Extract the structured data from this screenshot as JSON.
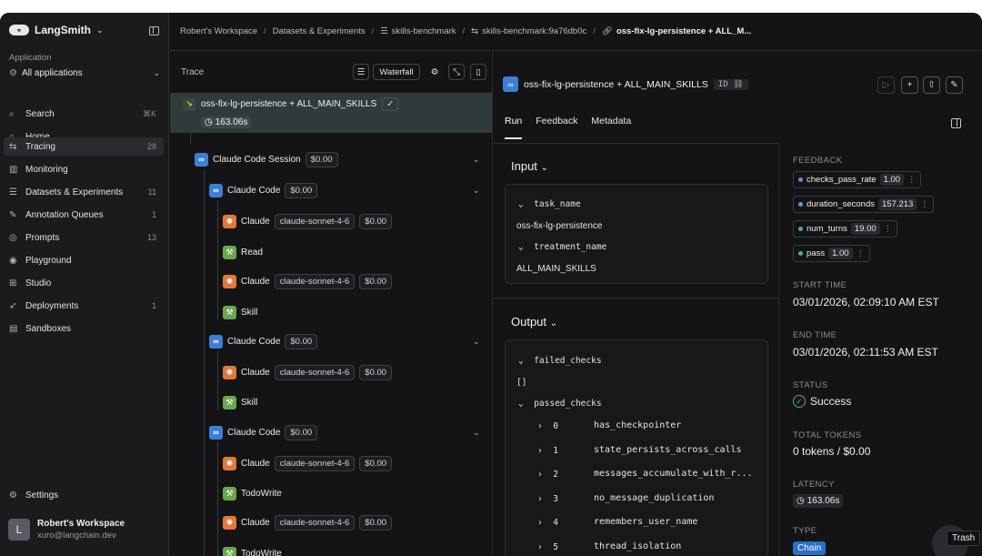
{
  "brand": {
    "name": "LangSmith"
  },
  "sidebar": {
    "app_label": "Application",
    "app_select": "All applications",
    "items": [
      {
        "label": "Search",
        "count": "⌘K",
        "icon": "search-icon"
      },
      {
        "label": "Home",
        "count": "",
        "icon": "home-icon"
      },
      {
        "label": "Tracing",
        "count": "28",
        "icon": "tracing-icon"
      },
      {
        "label": "Monitoring",
        "count": "",
        "icon": "monitoring-icon"
      },
      {
        "label": "Datasets & Experiments",
        "count": "11",
        "icon": "datasets-icon"
      },
      {
        "label": "Annotation Queues",
        "count": "1",
        "icon": "annotation-icon"
      },
      {
        "label": "Prompts",
        "count": "13",
        "icon": "prompts-icon"
      },
      {
        "label": "Playground",
        "count": "",
        "icon": "playground-icon"
      },
      {
        "label": "Studio",
        "count": "",
        "icon": "studio-icon"
      },
      {
        "label": "Deployments",
        "count": "1",
        "icon": "deployments-icon"
      },
      {
        "label": "Sandboxes",
        "count": "",
        "icon": "sandboxes-icon"
      }
    ],
    "settings": "Settings",
    "workspace": {
      "initial": "L",
      "name": "Robert's Workspace",
      "email": "xuro@langchain.dev"
    }
  },
  "breadcrumb": [
    "Robert's Workspace",
    "Datasets & Experiments",
    "skills-benchmark",
    "skills-benchmark:9a76db0c",
    "oss-fix-lg-persistence + ALL_M..."
  ],
  "trace": {
    "label": "Trace",
    "waterfall": "Waterfall",
    "root": {
      "title": "oss-fix-lg-persistence + ALL_MAIN_SKILLS",
      "time": "163.06s"
    },
    "session": {
      "title": "Claude Code Session",
      "cost": "$0.00"
    },
    "rows": [
      {
        "kind": "code",
        "label": "Claude Code",
        "cost": "$0.00"
      },
      {
        "kind": "llm",
        "label": "Claude",
        "model": "claude-sonnet-4-6",
        "cost": "$0.00"
      },
      {
        "kind": "tool",
        "label": "Read"
      },
      {
        "kind": "llm",
        "label": "Claude",
        "model": "claude-sonnet-4-6",
        "cost": "$0.00"
      },
      {
        "kind": "tool",
        "label": "Skill"
      },
      {
        "kind": "code",
        "label": "Claude Code",
        "cost": "$0.00"
      },
      {
        "kind": "llm",
        "label": "Claude",
        "model": "claude-sonnet-4-6",
        "cost": "$0.00"
      },
      {
        "kind": "tool",
        "label": "Skill"
      },
      {
        "kind": "code",
        "label": "Claude Code",
        "cost": "$0.00"
      },
      {
        "kind": "llm",
        "label": "Claude",
        "model": "claude-sonnet-4-6",
        "cost": "$0.00"
      },
      {
        "kind": "tool",
        "label": "TodoWrite"
      },
      {
        "kind": "llm",
        "label": "Claude",
        "model": "claude-sonnet-4-6",
        "cost": "$0.00"
      },
      {
        "kind": "tool",
        "label": "TodoWrite"
      }
    ]
  },
  "detail": {
    "title": "oss-fix-lg-persistence + ALL_MAIN_SKILLS",
    "id_label": "ID",
    "tabs": [
      "Run",
      "Feedback",
      "Metadata"
    ],
    "input": {
      "title": "Input",
      "task_key": "task_name",
      "task_value": "oss-fix-lg-persistence",
      "treatment_key": "treatment_name",
      "treatment_value": "ALL_MAIN_SKILLS"
    },
    "output": {
      "title": "Output",
      "failed_key": "failed_checks",
      "failed_value": "[]",
      "passed_key": "passed_checks",
      "passed": [
        {
          "i": "0",
          "v": "has_checkpointer"
        },
        {
          "i": "1",
          "v": "state_persists_across_calls"
        },
        {
          "i": "2",
          "v": "messages_accumulate_with_r..."
        },
        {
          "i": "3",
          "v": "no_message_duplication"
        },
        {
          "i": "4",
          "v": "remembers_user_name"
        },
        {
          "i": "5",
          "v": "thread_isolation"
        }
      ]
    },
    "meta": {
      "feedback_label": "FEEDBACK",
      "feedback": [
        {
          "name": "checks_pass_rate",
          "value": "1.00",
          "color": "#8a7fd4"
        },
        {
          "name": "duration_seconds",
          "value": "157.213",
          "color": "#5aa0d8"
        },
        {
          "name": "num_turns",
          "value": "19.00",
          "color": "#4fb07a"
        },
        {
          "name": "pass",
          "value": "1.00",
          "color": "#4fb07a"
        }
      ],
      "start_label": "START TIME",
      "start": "03/01/2026, 02:09:10 AM EST",
      "end_label": "END TIME",
      "end": "03/01/2026, 02:11:53 AM EST",
      "status_label": "STATUS",
      "status": "Success",
      "tokens_label": "TOTAL TOKENS",
      "tokens": "0 tokens / $0.00",
      "latency_label": "LATENCY",
      "latency": "163.06s",
      "type_label": "TYPE",
      "type": "Chain"
    }
  },
  "trash_tooltip": "Trash"
}
